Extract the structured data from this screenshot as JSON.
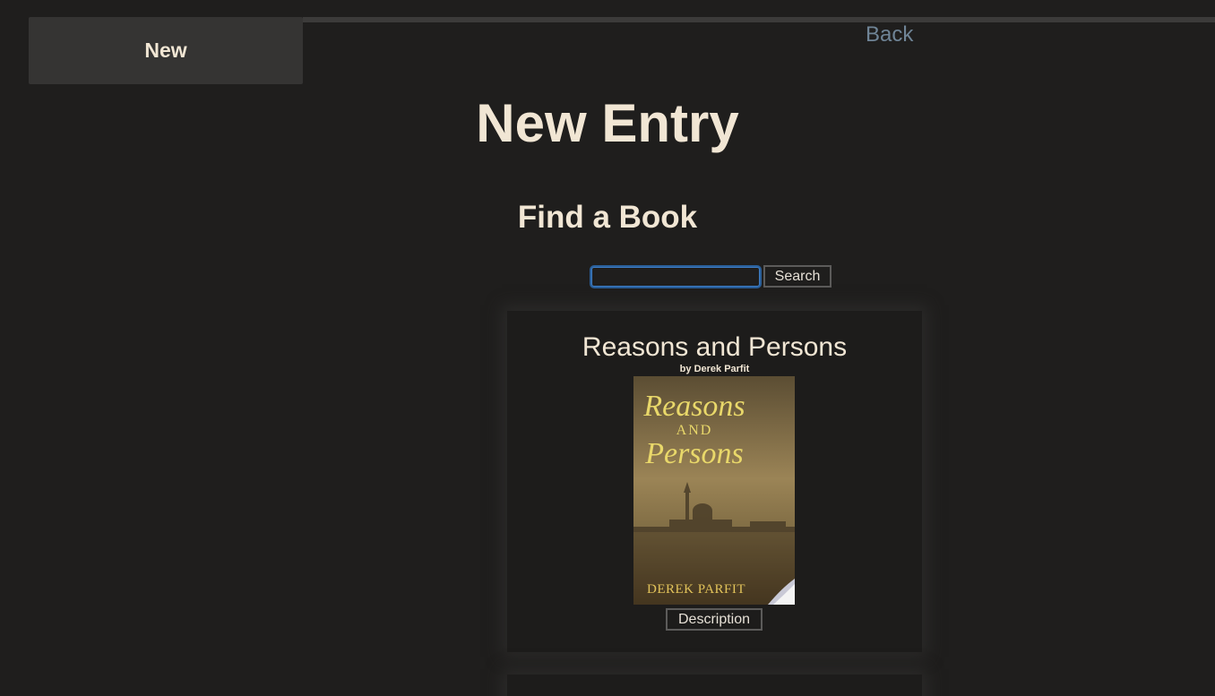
{
  "nav": {
    "new_tab_label": "New",
    "back_label": "Back"
  },
  "main": {
    "title": "New Entry",
    "find_heading": "Find a Book",
    "search": {
      "value": "",
      "placeholder": "",
      "button_label": "Search"
    },
    "results": [
      {
        "title": "Reasons and Persons",
        "author_line": "by Derek Parfit",
        "cover": {
          "title_line1": "Reasons",
          "title_line2": "AND",
          "title_line3": "Persons",
          "author": "DEREK PARFIT"
        },
        "description_label": "Description"
      }
    ]
  },
  "colors": {
    "background": "#1f1e1d",
    "text": "#f1e6d4",
    "link": "#6f8496",
    "focus": "#3f7fc7"
  }
}
